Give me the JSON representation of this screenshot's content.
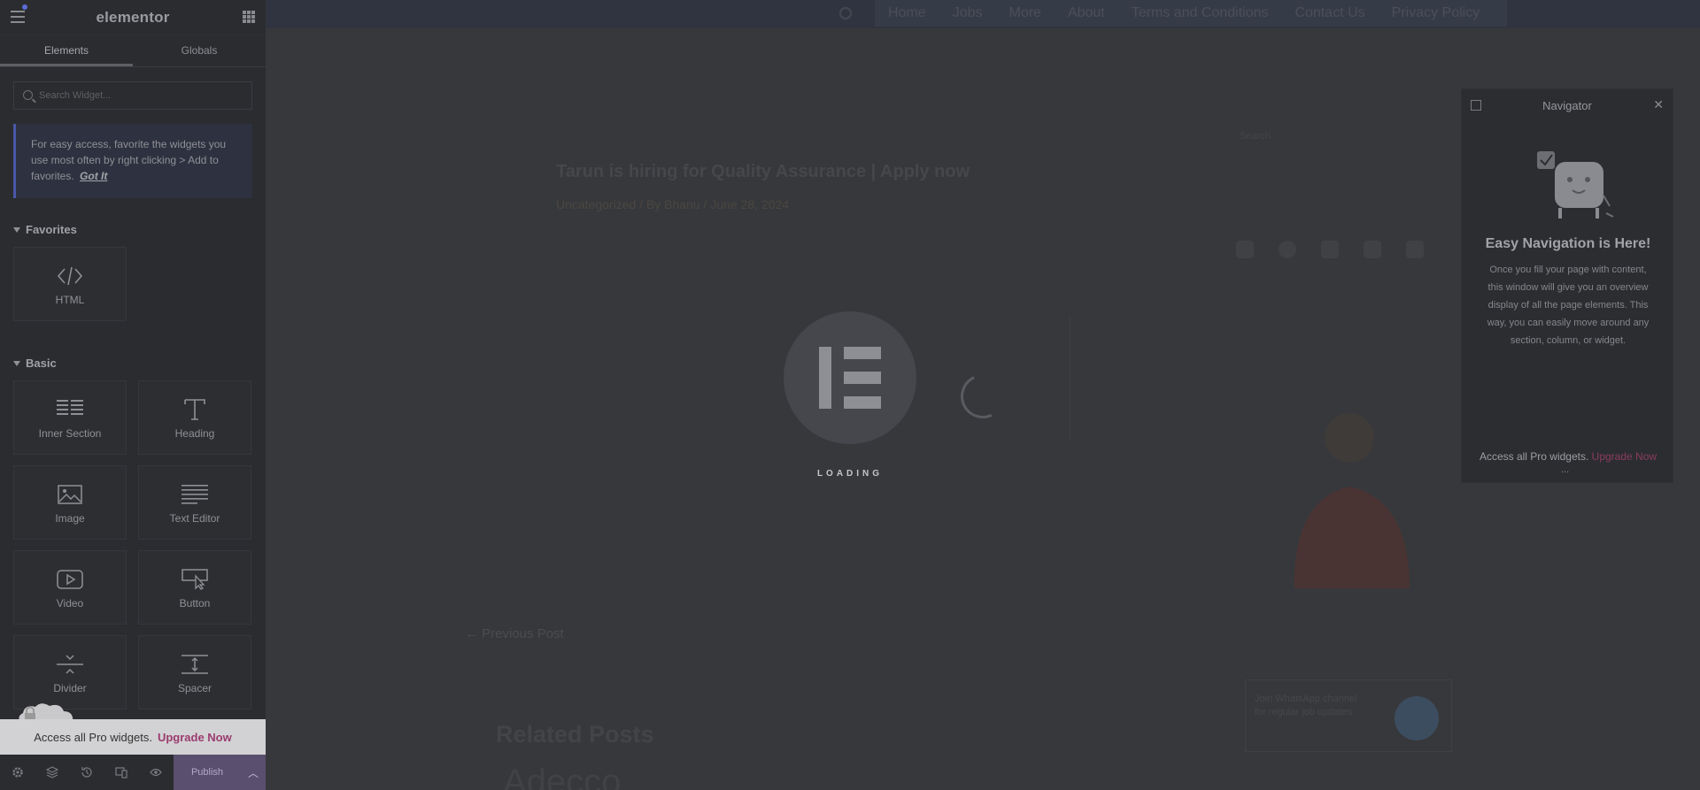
{
  "panel": {
    "logo": "elementor",
    "tabs": [
      "Elements",
      "Globals"
    ],
    "search_placeholder": "Search Widget...",
    "tip": {
      "text": "For easy access, favorite the widgets you use most often by right clicking > Add to favorites.",
      "gotit": "Got It"
    },
    "favorites": {
      "title": "Favorites",
      "items": [
        {
          "label": "HTML",
          "icon": "code-icon"
        }
      ]
    },
    "basic": {
      "title": "Basic",
      "items": [
        {
          "label": "Inner Section",
          "icon": "inner-section-icon"
        },
        {
          "label": "Heading",
          "icon": "heading-icon"
        },
        {
          "label": "Image",
          "icon": "image-icon"
        },
        {
          "label": "Text Editor",
          "icon": "text-editor-icon"
        },
        {
          "label": "Video",
          "icon": "video-icon"
        },
        {
          "label": "Button",
          "icon": "button-icon"
        },
        {
          "label": "Divider",
          "icon": "divider-icon"
        },
        {
          "label": "Spacer",
          "icon": "spacer-icon"
        }
      ]
    },
    "pro_banner": {
      "text": "Access all Pro widgets.",
      "link": "Upgrade Now"
    },
    "footer": {
      "publish": "Publish"
    }
  },
  "preview": {
    "nav": [
      "Home",
      "Jobs",
      "More",
      "About",
      "Terms and Conditions",
      "Contact Us",
      "Privacy Policy"
    ],
    "post_title": "Tarun is hiring for Quality Assurance | Apply now",
    "post_meta": "Uncategorized / By Bhanu / June 28, 2024",
    "sidebar_search": "Search",
    "prev_post": "← Previous Post",
    "related_posts": "Related Posts",
    "related_first": "Adecco",
    "cta_text": "Join WhatsApp channel for regular job updates"
  },
  "navigator": {
    "title": "Navigator",
    "heading": "Easy Navigation is Here!",
    "description": "Once you fill your page with content, this window will give you an overview display of all the page elements. This way, you can easily move around any section, column, or widget.",
    "pro_text": "Access all Pro widgets.",
    "pro_link": "Upgrade Now",
    "more": "..."
  },
  "loading": {
    "text": "LOADING"
  }
}
